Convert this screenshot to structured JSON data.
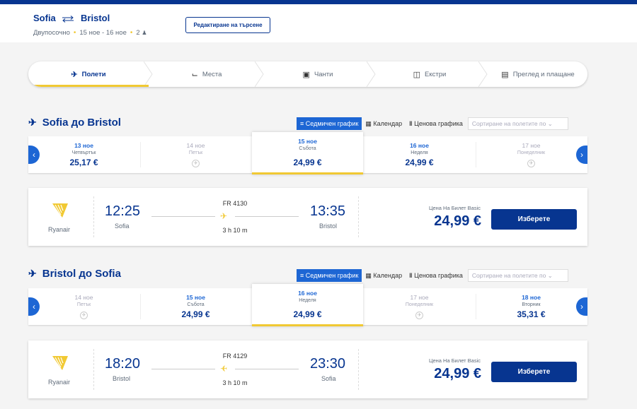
{
  "header": {
    "origin": "Sofia",
    "destination": "Bristol",
    "trip_type": "Двупосочно",
    "dates": "15 ное - 16 ное",
    "passengers": "2",
    "edit_label": "Редактиране на търсене"
  },
  "steps": [
    {
      "label": "Полети",
      "icon": "plane-icon",
      "active": true
    },
    {
      "label": "Места",
      "icon": "seat-icon",
      "active": false
    },
    {
      "label": "Чанти",
      "icon": "bag-icon",
      "active": false
    },
    {
      "label": "Екстри",
      "icon": "extras-icon",
      "active": false
    },
    {
      "label": "Преглед и плащане",
      "icon": "payment-icon",
      "active": false
    }
  ],
  "view_tabs": {
    "weekly": "Седмичен график",
    "calendar": "Календар",
    "price_chart": "Ценова графика",
    "sort_placeholder": "Сортиране на полетите по"
  },
  "outbound": {
    "title": "Sofia до Bristol",
    "dates": [
      {
        "day": "13 ное",
        "weekday": "Четвъртък",
        "price": "25,17 €",
        "available": true,
        "selected": false
      },
      {
        "day": "14 ное",
        "weekday": "Петък",
        "price": "",
        "available": false,
        "selected": false
      },
      {
        "day": "15 ное",
        "weekday": "Събота",
        "price": "24,99 €",
        "available": true,
        "selected": true
      },
      {
        "day": "16 ное",
        "weekday": "Неделя",
        "price": "24,99 €",
        "available": true,
        "selected": false
      },
      {
        "day": "17 ное",
        "weekday": "Понеделник",
        "price": "",
        "available": false,
        "selected": false
      }
    ],
    "flight": {
      "airline": "Ryanair",
      "dep_time": "12:25",
      "dep_city": "Sofia",
      "flight_no": "FR 4130",
      "duration": "3 h 10 m",
      "arr_time": "13:35",
      "arr_city": "Bristol",
      "price_label": "Цена На Билет Basic",
      "price": "24,99 €",
      "select_label": "Изберете"
    }
  },
  "inbound": {
    "title": "Bristol до Sofia",
    "dates": [
      {
        "day": "14 ное",
        "weekday": "Петък",
        "price": "",
        "available": false,
        "selected": false
      },
      {
        "day": "15 ное",
        "weekday": "Събота",
        "price": "24,99 €",
        "available": true,
        "selected": false
      },
      {
        "day": "16 ное",
        "weekday": "Неделя",
        "price": "24,99 €",
        "available": true,
        "selected": true
      },
      {
        "day": "17 ное",
        "weekday": "Понеделник",
        "price": "",
        "available": false,
        "selected": false
      },
      {
        "day": "18 ное",
        "weekday": "Вторник",
        "price": "35,31 €",
        "available": true,
        "selected": false
      }
    ],
    "flight": {
      "airline": "Ryanair",
      "dep_time": "18:20",
      "dep_city": "Bristol",
      "flight_no": "FR 4129",
      "duration": "3 h 10 m",
      "arr_time": "23:30",
      "arr_city": "Sofia",
      "price_label": "Цена На Билет Basic",
      "price": "24,99 €",
      "select_label": "Изберете"
    }
  },
  "colors": {
    "brand": "#073590",
    "accent": "#f1c933",
    "link": "#1d66d4"
  }
}
